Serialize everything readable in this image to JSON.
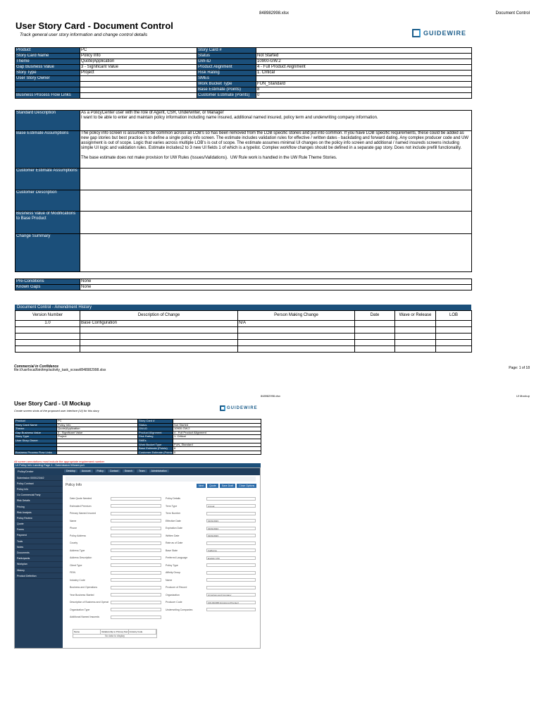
{
  "page1": {
    "file_name": "848982998.xlsx",
    "sheet_name": "Document Control",
    "title": "User Story Card - Document Control",
    "subtitle": "Track general user story information and change control details",
    "logo_text": "GUIDEWIRE",
    "info_rows": [
      {
        "l1": "Product",
        "v1": "PC",
        "l2": "Story Card #",
        "v2": ""
      },
      {
        "l1": "Story Card Name",
        "v1": "Policy Info",
        "l2": "Status",
        "v2": "Not Started"
      },
      {
        "l1": "Theme",
        "v1": "Quote|Application",
        "l2": "GW-ID",
        "v2": "10900-GW.2"
      },
      {
        "l1": "Gap Business Value",
        "v1": "3 - Significant Value",
        "l2": "Product Alignment",
        "v2": "4 - Full Product Alignment"
      },
      {
        "l1": "Story Type",
        "v1": "Project",
        "l2": "Risk Rating",
        "v2": "1. Critical"
      },
      {
        "l1": "User Story Owner",
        "v1": "",
        "l2": "SMEs",
        "v2": ""
      },
      {
        "l1": "",
        "v1": "",
        "l2": "Work Bucket Type",
        "v2": "FUN_Standard"
      },
      {
        "l1": "",
        "v1": "",
        "l2": "Base Estimate (Points)",
        "v2": "8"
      },
      {
        "l1": "Business Process Flow Links",
        "v1": "",
        "l2": "Customer Estimate (Points)",
        "v2": "0"
      }
    ],
    "desc_rows": [
      {
        "label": "Standard Description",
        "value": "As a PolicyCenter user with the role of Agent, CSR, Underwriter, or Manager\nI want to be able to enter and maintain policy information including name insured, additional named insured, policy term and underwriting company information."
      },
      {
        "label": "Base Estimate Assumptions",
        "value": "The policy info screen is assumed to be common across all LOB's so has been removed from the LOB specific stories and put into common. If you have LOB specific requirements, these could be added as new gap stories but best practice is to define a single policy info screen. The estimate includes validation rules for effective / written dates - backdating and forward dating. Any complex producer code and UW assignment is out of scope. Logic that varies across multiple LOB's is out of scope. The estimate assumes minimal UI changes on the policy info screen and additional / named insureds screens including simple UI logic and validation rules. Estimate includes2 to 3 new UI fields 1 of which is a typelist. Complex workflow changes should be defined in a separate gap story. Does not include prefill functionality.\n\nThe base estimate does not make provision for UW Rules (Issues/Validations).  UW Rule work is handled in the UW Rule Theme Stories."
      },
      {
        "label": "Customer Estimate Assumptions",
        "value": ""
      },
      {
        "label": "Customer Description",
        "value": ""
      },
      {
        "label": "Business Value of  Modifications to Base Product",
        "value": ""
      },
      {
        "label": "Change Summary",
        "value": ""
      }
    ],
    "pre_rows": [
      {
        "label": "Pre-Conditions",
        "value": "None"
      },
      {
        "label": "Known Gaps",
        "value": "None"
      }
    ],
    "dc_title": "Document Control - Amendment History",
    "dc_headers": [
      "Version Number",
      "Description of Change",
      "Person Making Change",
      "Date",
      "Wave or Release",
      "LOB"
    ],
    "dc_rows": [
      [
        "1.0",
        "Base Configuration",
        "N/A",
        "",
        "",
        ""
      ],
      [
        "",
        "",
        "",
        "",
        "",
        ""
      ],
      [
        "",
        "",
        "",
        "",
        "",
        ""
      ],
      [
        "",
        "",
        "",
        "",
        "",
        ""
      ],
      [
        "",
        "",
        "",
        "",
        "",
        ""
      ]
    ],
    "footer_conf": "Commercial in Confidence",
    "footer_path": "file:///usr/local/bin/tmp/activity_task_xcrawl/848982998.xlsx",
    "footer_page": "Page: 1 of 18"
  },
  "page2": {
    "file_name": "848982998.xlsx",
    "sheet_name": "UI Mockup",
    "title": "User Story Card - UI Mockup",
    "subtitle": "Create screen shots of the proposed user interface (UI) for this story",
    "logo_text": "GUIDEWIRE",
    "info_rows": [
      {
        "l1": "Product",
        "v1": "PC",
        "l2": "Story Card #",
        "v2": ""
      },
      {
        "l1": "Story Card Name",
        "v1": "Policy Info",
        "l2": "Status",
        "v2": "Not Started"
      },
      {
        "l1": "Theme",
        "v1": "Quote|Application",
        "l2": "GW-ID",
        "v2": "10900-GW.2"
      },
      {
        "l1": "Gap Business Value",
        "v1": "3 - Significant Value",
        "l2": "Product Alignment",
        "v2": "4 - Full Product Alignment"
      },
      {
        "l1": "Story Type",
        "v1": "Project",
        "l2": "Risk Rating",
        "v2": "1. Critical"
      },
      {
        "l1": "User Story Owner",
        "v1": "",
        "l2": "SMEs",
        "v2": ""
      },
      {
        "l1": "",
        "v1": "",
        "l2": "Work Bucket Type",
        "v2": "FUN_Standard"
      },
      {
        "l1": "",
        "v1": "",
        "l2": "Base Estimate (Points)",
        "v2": "8"
      },
      {
        "l1": "Business Process Flow Links",
        "v1": "",
        "l2": "Customer Estimate (Points)",
        "v2": "0"
      }
    ],
    "note": "All screen annotations must include the appropriate requirement number",
    "pc_title": "UI Policy Info Landing Page 1 - Submission Wizard.pc1",
    "app_name": "PolicyCenter",
    "tabs": [
      "Desktop",
      "Account",
      "Policy",
      "Contact",
      "Search",
      "Team",
      "Administration"
    ],
    "screen_title": "Policy Info",
    "buttons": [
      "Next",
      "Quote",
      "Save Draft",
      "Close Options"
    ],
    "side_items": [
      "Submission 0000123442",
      "Policy Contract",
      "Policy Info",
      "Go Commercial Party",
      "Risk Details",
      "Pricing",
      "Risk Analysis",
      "Policy Review",
      "Quote",
      "Forms",
      "Payment",
      "Tools",
      "Notes",
      "Documents",
      "Participants",
      "Workplan",
      "History",
      "Product Definition"
    ],
    "left_fields": [
      "Date Quote Needed",
      "Estimated Premium",
      "Primary Named Insured",
      "Name",
      "Phone",
      "Policy Address",
      "County",
      "Address Type",
      "Address Description",
      "Client Type",
      "FEIN",
      "Industry Code",
      "Business and Operations",
      "Year Business Started",
      "Description of Business and Operations",
      "Organization Type",
      "Additional Named Insureds"
    ],
    "right_fields": [
      "Policy Details",
      "Term Type",
      "Term Number",
      "Effective Date",
      "Expiration Date",
      "Written Date",
      "Rate as of Date",
      "Base State",
      "Preferred Language",
      "Policy Type",
      "Affinity Group",
      "Name",
      "Producer of Record",
      "Organization",
      "Producer Code",
      "Underwriting Companies"
    ],
    "right_values": [
      "",
      "Annual",
      "",
      "01/01/2023",
      "01/01/2024",
      "01/01/2023",
      "",
      "California",
      "English (US)",
      "",
      "",
      "",
      "",
      "Armstrong and Company",
      "100-002458 Armstrong (Premier)",
      ""
    ],
    "table_cols": [
      "Name",
      "Relationship to Primary Named Insured",
      "Industry Code"
    ],
    "table_empty": "No data to display"
  }
}
